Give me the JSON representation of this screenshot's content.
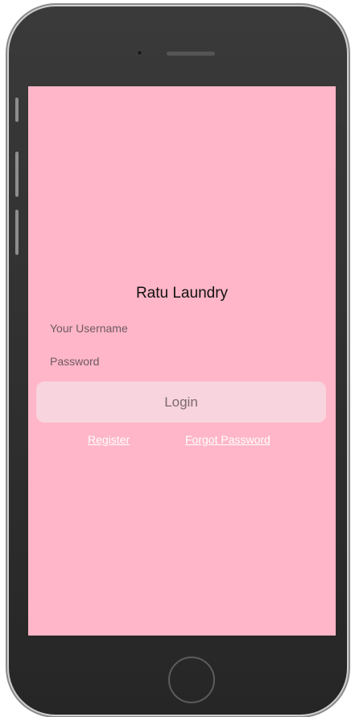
{
  "app": {
    "title": "Ratu Laundry"
  },
  "login_form": {
    "username_placeholder": "Your Username",
    "password_placeholder": "Password",
    "login_label": "Login"
  },
  "links": {
    "register": "Register",
    "forgot_password": "Forgot Password"
  },
  "colors": {
    "screen_background": "#ffb6c8",
    "login_button_background": "#f8d4de",
    "link_color": "#ffffff"
  }
}
